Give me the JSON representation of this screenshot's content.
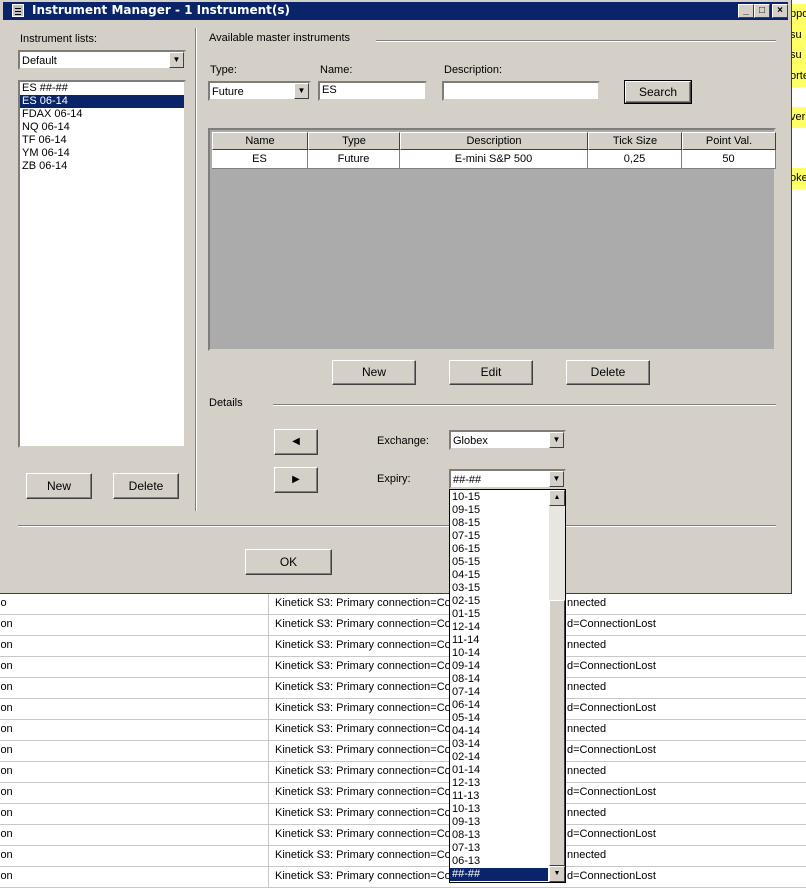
{
  "background": {
    "rows": [
      {
        "col1": "io",
        "col2": "Kinetick  S3: Primary connection=Co",
        "col3": "nnected"
      },
      {
        "col1": "ion",
        "col2": "Kinetick  S3: Primary connection=Co",
        "col3": "d=ConnectionLost"
      },
      {
        "col1": "ion",
        "col2": "Kinetick  S3: Primary connection=Co",
        "col3": "nnected"
      },
      {
        "col1": "ion",
        "col2": "Kinetick  S3: Primary connection=Co",
        "col3": "d=ConnectionLost"
      },
      {
        "col1": "ion",
        "col2": "Kinetick  S3: Primary connection=Co",
        "col3": "nnected"
      },
      {
        "col1": "ion",
        "col2": "Kinetick  S3: Primary connection=Co",
        "col3": "d=ConnectionLost"
      },
      {
        "col1": "ion",
        "col2": "Kinetick  S3: Primary connection=Co",
        "col3": "nnected"
      },
      {
        "col1": "ion",
        "col2": "Kinetick  S3: Primary connection=Co",
        "col3": "d=ConnectionLost"
      },
      {
        "col1": "ion",
        "col2": "Kinetick  S3: Primary connection=Co",
        "col3": "nnected"
      },
      {
        "col1": "ion",
        "col2": "Kinetick  S3: Primary connection=Co",
        "col3": "d=ConnectionLost"
      },
      {
        "col1": "ion",
        "col2": "Kinetick  S3: Primary connection=Co",
        "col3": "nnected"
      },
      {
        "col1": "ion",
        "col2": "Kinetick  S3: Primary connection=Co",
        "col3": "d=ConnectionLost"
      },
      {
        "col1": "ion",
        "col2": "Kinetick  S3: Primary connection=Co",
        "col3": "nnected"
      },
      {
        "col1": "ion",
        "col2": "Kinetick  S3: Primary connection=Co",
        "col3": "d=ConnectionLost"
      }
    ],
    "left_fragment": "io",
    "right_fragments": [
      "ppo",
      "su",
      "su",
      "orte",
      "",
      "verb",
      "",
      "",
      "oken"
    ],
    "highlight_color": "#ffff66"
  },
  "dialog": {
    "title": "Instrument Manager - 1 Instrument(s)",
    "window_buttons": {
      "minimize": "_",
      "maximize": "□",
      "close": "×"
    },
    "instrument_lists_label": "Instrument lists:",
    "instrument_list_combo": "Default",
    "instruments": [
      "ES ##-##",
      "ES 06-14",
      "FDAX 06-14",
      "NQ 06-14",
      "TF 06-14",
      "YM 06-14",
      "ZB 06-14"
    ],
    "selected_instrument_index": 1,
    "left_new": "New",
    "left_delete": "Delete",
    "available_master_label": "Available master instruments",
    "type_label": "Type:",
    "type_value": "Future",
    "name_label": "Name:",
    "name_value": "ES",
    "description_label": "Description:",
    "description_value": "",
    "search_button": "Search",
    "grid": {
      "headers": [
        "Name",
        "Type",
        "Description",
        "Tick Size",
        "Point Val."
      ],
      "rows": [
        [
          "ES",
          "Future",
          "E-mini S&P 500",
          "0,25",
          "50"
        ]
      ]
    },
    "new_button": "New",
    "edit_button": "Edit",
    "delete_button": "Delete",
    "details_label": "Details",
    "arrow_left": "◀",
    "arrow_right": "▶",
    "exchange_label": "Exchange:",
    "exchange_value": "Globex",
    "expiry_label": "Expiry:",
    "expiry_value": "##-##",
    "ok_button": "OK",
    "combo_arrow": "▼"
  },
  "expiry_dropdown": {
    "items": [
      "10-15",
      "09-15",
      "08-15",
      "07-15",
      "06-15",
      "05-15",
      "04-15",
      "03-15",
      "02-15",
      "01-15",
      "12-14",
      "11-14",
      "10-14",
      "09-14",
      "08-14",
      "07-14",
      "06-14",
      "05-14",
      "04-14",
      "03-14",
      "02-14",
      "01-14",
      "12-13",
      "11-13",
      "10-13",
      "09-13",
      "08-13",
      "07-13",
      "06-13",
      "##-##"
    ],
    "selected_index": 29,
    "scroll_up": "▲",
    "scroll_down": "▼"
  }
}
